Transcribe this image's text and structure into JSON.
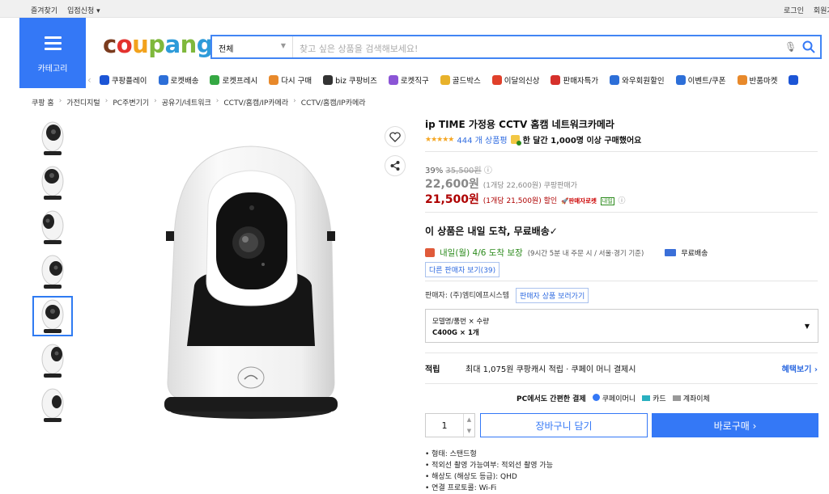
{
  "topbar": {
    "left": [
      "즐겨찾기",
      "입점신청 ▾"
    ],
    "right": [
      "로그인",
      "회원가입"
    ]
  },
  "category": {
    "label": "카테고리"
  },
  "logo": {
    "text": "coupang"
  },
  "search": {
    "scope": "전체",
    "placeholder": "찾고 싶은 상품을 검색해보세요!"
  },
  "menu": [
    {
      "label": "쿠팡플레이",
      "color": "#1c55d6"
    },
    {
      "label": "로켓배송",
      "color": "#2d6fd8"
    },
    {
      "label": "로켓프레시",
      "color": "#35a843"
    },
    {
      "label": "다시 구매",
      "color": "#e8892b"
    },
    {
      "label": "biz 쿠팡비즈",
      "color": "#333333"
    },
    {
      "label": "로켓직구",
      "color": "#8b55d6"
    },
    {
      "label": "골드박스",
      "color": "#e8b22b"
    },
    {
      "label": "이달의신상",
      "color": "#e0402b"
    },
    {
      "label": "판매자특가",
      "color": "#d6302b"
    },
    {
      "label": "와우회원할인",
      "color": "#2d6fd8"
    },
    {
      "label": "이벤트/쿠폰",
      "color": "#2d6fd8"
    },
    {
      "label": "반품마켓",
      "color": "#e8892b"
    },
    {
      "label": "",
      "color": "#1c55d6"
    }
  ],
  "breadcrumb": [
    "쿠팡 홈",
    "가전디지털",
    "PC주변기기",
    "공유기/네트워크",
    "CCTV/홈캠/IP카메라",
    "CCTV/홈캠/IP카메라"
  ],
  "product": {
    "title": "ip TIME 가정용 CCTV 홈캠 네트워크카메라",
    "stars": "★★★★★",
    "reviews": "444 개 상품평",
    "monthly": "한 달간 1,000명 이상 구매했어요",
    "discount": "39%",
    "original": "35,500원",
    "price": "22,600원",
    "price_unit": "(1개당 22,600원) 쿠팡판매가",
    "sale": "21,500원",
    "sale_unit": "(1개당 21,500원) 할인",
    "seller_badge": "판매자로켓",
    "tomorrow": "내일",
    "delivery_headline": "이 상품은 내일 도착, 무료배송✓",
    "delivery_date": "내일(월) 4/6 도착 보장",
    "delivery_note": "(9시간 5분 내 주문 시 / 서울·경기 기준)",
    "free_ship": "무료배송",
    "other_sellers": "다른 판매자 보기(39)",
    "seller": "판매자: (주)엠티에프시스템",
    "seller_link": "판매자 상품 보러가기",
    "option_label": "모델명/품번 × 수량",
    "option_value": "C400G × 1개",
    "points_label": "적립",
    "points_text": "최대 1,075원 쿠팡캐시 적립 · 쿠페이 머니 결제시",
    "benefit": "혜택보기 ›",
    "pay_title": "PC에서도 간편한 결제",
    "pay_options": [
      "쿠페이머니",
      "카드",
      "계좌이체"
    ],
    "qty": "1",
    "cart": "장바구니 담기",
    "buy": "바로구매 ›",
    "specs": [
      "형태: 스탠드형",
      "적외선 촬영 가능여부: 적외선 촬영 가능",
      "해상도 (해상도 등급): QHD",
      "연결 프로토콜: Wi-Fi"
    ]
  }
}
